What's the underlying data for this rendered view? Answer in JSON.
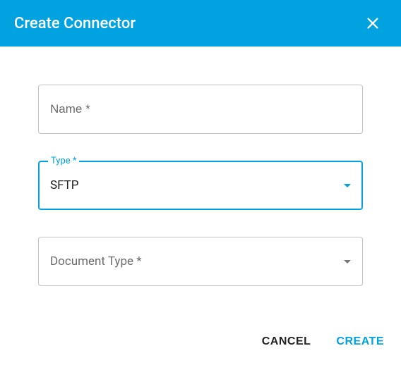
{
  "header": {
    "title": "Create Connector"
  },
  "form": {
    "name": {
      "label": "Name *",
      "value": ""
    },
    "type": {
      "label": "Type *",
      "value": "SFTP"
    },
    "documentType": {
      "label": "Document Type *",
      "value": ""
    }
  },
  "actions": {
    "cancel": "CANCEL",
    "create": "CREATE"
  }
}
